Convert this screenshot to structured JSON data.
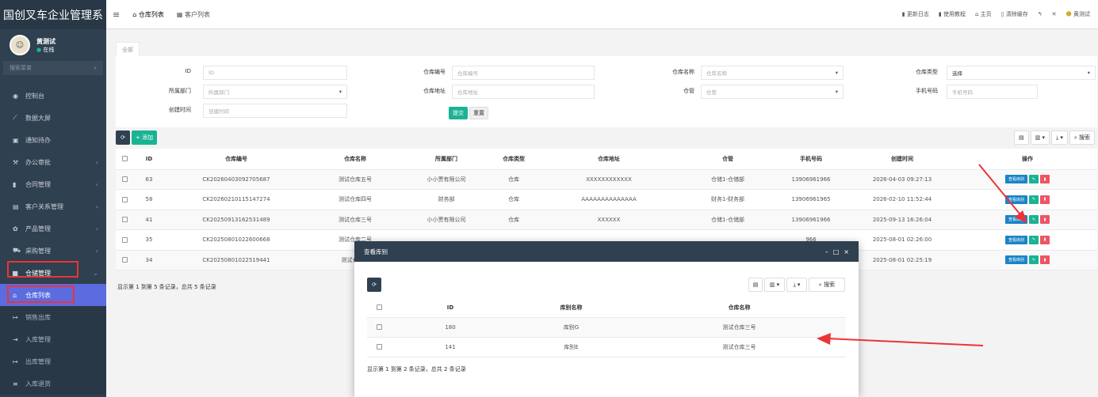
{
  "app": {
    "title": "国创叉车企业管理系"
  },
  "user": {
    "name": "黄测试",
    "status": "在线"
  },
  "sidebar": {
    "search_placeholder": "搜索菜单",
    "items": [
      {
        "label": "控制台"
      },
      {
        "label": "数据大屏"
      },
      {
        "label": "通知待办"
      },
      {
        "label": "办公审批"
      },
      {
        "label": "合同管理"
      },
      {
        "label": "客户关系管理"
      },
      {
        "label": "产品管理"
      },
      {
        "label": "采购管理"
      },
      {
        "label": "仓储管理"
      },
      {
        "label": "仓库列表"
      },
      {
        "label": "销售出库"
      },
      {
        "label": "入库管理"
      },
      {
        "label": "出库管理"
      },
      {
        "label": "入库退货"
      }
    ]
  },
  "topbar": {
    "tabs": [
      {
        "label": "仓库列表"
      },
      {
        "label": "客户列表"
      }
    ],
    "links": {
      "changelog": "更新日志",
      "tutorial": "使用教程",
      "home": "主页",
      "clear_cache": "清除缓存",
      "username": "黄测试"
    }
  },
  "page": {
    "tab": "全部"
  },
  "filter": {
    "id_label": "ID",
    "id_placeholder": "ID",
    "code_label": "仓库编号",
    "code_placeholder": "仓库编号",
    "name_label": "仓库名称",
    "name_placeholder": "仓库名称",
    "type_label": "仓库类型",
    "type_value": "选择",
    "dept_label": "所属部门",
    "dept_placeholder": "所属部门",
    "addr_label": "仓库地址",
    "addr_placeholder": "仓库地址",
    "mgr_label": "仓管",
    "mgr_placeholder": "仓管",
    "phone_label": "手机号码",
    "phone_placeholder": "手机号码",
    "time_label": "创建时间",
    "time_placeholder": "创建时间",
    "submit": "提交",
    "reset": "重置"
  },
  "toolbar": {
    "add": "+ 添加",
    "search": "搜索"
  },
  "table": {
    "headers": [
      "ID",
      "仓库编号",
      "仓库名称",
      "所属部门",
      "仓库类型",
      "仓库地址",
      "仓管",
      "手机号码",
      "创建时间",
      "操作"
    ],
    "rows": [
      {
        "id": "63",
        "code": "CK20260403092705687",
        "name": "测试仓库五号",
        "dept": "小小贾有限公司",
        "type": "仓库",
        "addr": "XXXXXXXXXXXX",
        "mgr": "仓储1-仓储部",
        "phone": "13906961966",
        "time": "2026-04-03 09:27:13"
      },
      {
        "id": "58",
        "code": "CK20260210115147274",
        "name": "测试仓库四号",
        "dept": "财务部",
        "type": "仓库",
        "addr": "AAAAAAAAAAAAAA",
        "mgr": "财务1-财务部",
        "phone": "13906961965",
        "time": "2026-02-10 11:52:44"
      },
      {
        "id": "41",
        "code": "CK20250913162531489",
        "name": "测试仓库三号",
        "dept": "小小贾有限公司",
        "type": "仓库",
        "addr": "XXXXXX",
        "mgr": "仓储1-仓储部",
        "phone": "13906961966",
        "time": "2025-09-13 16:26:04"
      },
      {
        "id": "35",
        "code": "CK20250801022600668",
        "name": "测试仓库二号",
        "dept": "",
        "type": "",
        "addr": "",
        "mgr": "",
        "phone": "966",
        "time": "2025-08-01 02:26:00"
      },
      {
        "id": "34",
        "code": "CK20250801022519441",
        "name": "测试仓库一",
        "dept": "",
        "type": "",
        "addr": "",
        "mgr": "",
        "phone": "66",
        "time": "2025-08-01 02:25:19"
      }
    ],
    "op_view": "查看库别",
    "footer": "显示第 1 到第 5 条记录，总共 5 条记录"
  },
  "modal": {
    "title": "查看库别",
    "search": "搜索",
    "headers": [
      "ID",
      "库别名称",
      "仓库名称"
    ],
    "rows": [
      {
        "id": "180",
        "name": "库别G",
        "warehouse": "测试仓库三号"
      },
      {
        "id": "141",
        "name": "库别E",
        "warehouse": "测试仓库三号"
      }
    ],
    "footer": "显示第 1 到第 2 条记录，总共 2 条记录"
  },
  "colors": {
    "sidebar": "#2f4050",
    "primary": "#1ab394",
    "info": "#1c84c6",
    "danger": "#ed5565",
    "annotation": "#e33333"
  }
}
